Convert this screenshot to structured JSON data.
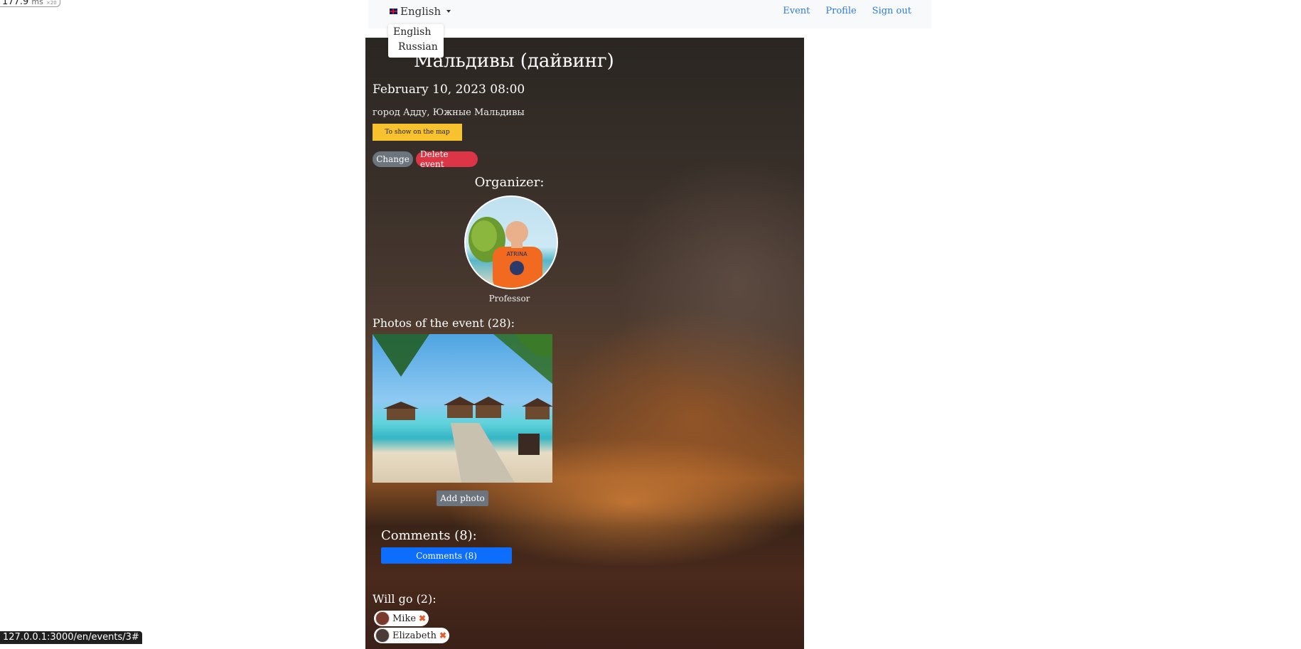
{
  "perf": {
    "value": "177.9",
    "unit": "ms",
    "sub": "×20"
  },
  "nav": {
    "language": "English",
    "links": [
      "Event",
      "Profile",
      "Sign out"
    ]
  },
  "language_menu": {
    "options": [
      "English",
      "Russian"
    ]
  },
  "event": {
    "title": "Мальдивы (дайвинг)",
    "datetime": "February 10, 2023 08:00",
    "address": "город Адду, Южные Мальдивы",
    "map_button": "To show on the map",
    "change_button": "Change",
    "delete_button": "Delete event",
    "organizer_label": "Organizer:",
    "organizer_name": "Professor",
    "photos_label": "Photos of the event (28):",
    "add_photo": "Add photo",
    "comments_label": "Comments (8):",
    "comments_button": "Comments (8)",
    "willgo_label": "Will go (2):",
    "attendees": [
      "Mike",
      "Elizabeth"
    ]
  },
  "status_url": "127.0.0.1:3000/en/events/3#",
  "colors": {
    "link": "#2c7be5",
    "map_button": "#f8c22f",
    "change": "#6c757d",
    "delete": "#dc3545",
    "comments": "#0d6efd"
  }
}
